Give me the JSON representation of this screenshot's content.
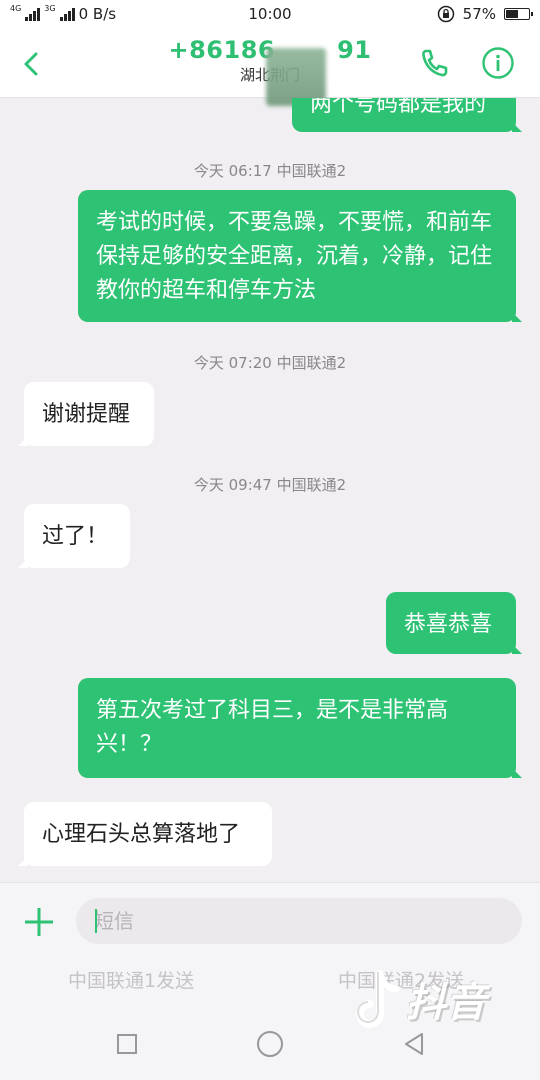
{
  "status_bar": {
    "network_label": "4G",
    "network2_label": "3G",
    "speed": "0 B/s",
    "time": "10:00",
    "battery": "57%",
    "battery_level": 0.57
  },
  "header": {
    "title": "+86186",
    "title_tail": "91",
    "subtitle": "湖北荆门"
  },
  "messages": {
    "partial_top": "两个号码都是我的",
    "ts1": "今天 06:17   中国联通2",
    "out1": "考试的时候，不要急躁，不要慌，和前车保持足够的安全距离，沉着，冷静，记住教你的超车和停车方法",
    "ts2": "今天 07:20   中国联通2",
    "in1": "谢谢提醒",
    "ts3": "今天 09:47   中国联通2",
    "in2": "过了！",
    "out2": "恭喜恭喜",
    "out3": "第五次考过了科目三，是不是非常高兴！？",
    "in3": "心理石头总算落地了"
  },
  "composer": {
    "placeholder": "短信",
    "send_sim1": "中国联通1发送",
    "send_sim2": "中国联通2发送"
  },
  "watermark": {
    "text": "抖音"
  },
  "colors": {
    "accent": "#2ec374",
    "background": "#f1eff2",
    "incoming_bubble": "#ffffff"
  }
}
